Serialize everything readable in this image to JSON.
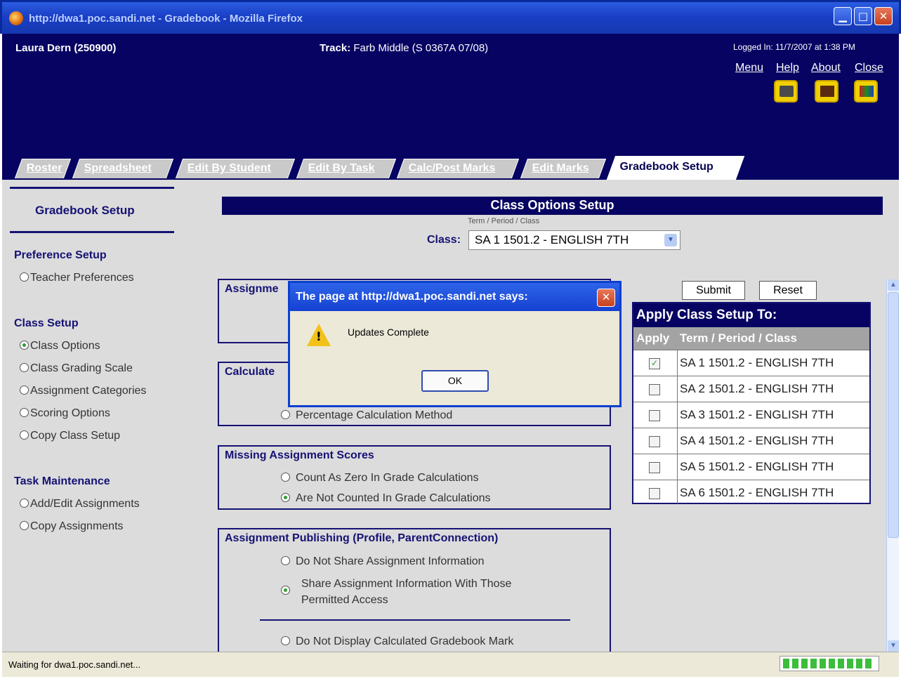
{
  "window": {
    "title": "http://dwa1.poc.sandi.net - Gradebook - Mozilla Firefox"
  },
  "header": {
    "user": "Laura Dern (250900)",
    "track_label": "Track:",
    "track_value": "Farb Middle (S 0367A 07/08)",
    "logged_in": "Logged In: 11/7/2007 at 1:38 PM",
    "links": [
      "Menu",
      "Help",
      "About",
      "Close"
    ],
    "icons": [
      "print-icon",
      "gradebook-icon",
      "report-icon"
    ]
  },
  "tabs": [
    "Roster",
    "Spreadsheet",
    "Edit By Student",
    "Edit By Task",
    "Calc/Post Marks",
    "Edit Marks",
    "Gradebook Setup"
  ],
  "sidebar": {
    "title": "Gradebook Setup",
    "sections": [
      {
        "heading": "Preference Setup",
        "items": [
          {
            "label": "Teacher Preferences",
            "selected": false
          }
        ]
      },
      {
        "heading": "Class Setup",
        "items": [
          {
            "label": "Class Options",
            "selected": true
          },
          {
            "label": "Class Grading Scale",
            "selected": false
          },
          {
            "label": "Assignment Categories",
            "selected": false
          },
          {
            "label": "Scoring Options",
            "selected": false
          },
          {
            "label": "Copy Class Setup",
            "selected": false
          }
        ]
      },
      {
        "heading": "Task Maintenance",
        "items": [
          {
            "label": "Add/Edit Assignments",
            "selected": false
          },
          {
            "label": "Copy Assignments",
            "selected": false
          }
        ]
      }
    ]
  },
  "main": {
    "title": "Class Options Setup",
    "class_caption": "Term / Period / Class",
    "class_label": "Class:",
    "class_value": "SA  1  1501.2 - ENGLISH 7TH",
    "groups": {
      "assignment": {
        "title": "Assignme"
      },
      "calculate": {
        "title": "Calculate",
        "option": "Percentage Calculation Method"
      },
      "missing": {
        "title": "Missing Assignment Scores",
        "options": [
          "Count As Zero In Grade Calculations",
          "Are Not Counted In Grade Calculations"
        ]
      },
      "publishing": {
        "title": "Assignment Publishing (Profile, ParentConnection)",
        "options": [
          "Do Not Share Assignment Information",
          "Share Assignment Information With Those",
          "Permitted Access",
          "Do Not Display Calculated Gradebook Mark"
        ]
      }
    }
  },
  "apply_panel": {
    "submit": "Submit",
    "reset": "Reset",
    "title": "Apply Class Setup To:",
    "col_apply": "Apply",
    "col_class": "Term / Period / Class",
    "rows": [
      {
        "checked": true,
        "label": "SA  1  1501.2 - ENGLISH 7TH"
      },
      {
        "checked": false,
        "label": "SA  2  1501.2 - ENGLISH 7TH"
      },
      {
        "checked": false,
        "label": "SA  3  1501.2 - ENGLISH 7TH"
      },
      {
        "checked": false,
        "label": "SA  4  1501.2 - ENGLISH 7TH"
      },
      {
        "checked": false,
        "label": "SA  5  1501.2 - ENGLISH 7TH"
      },
      {
        "checked": false,
        "label": "SA  6  1501.2 - ENGLISH 7TH"
      }
    ]
  },
  "dialog": {
    "title": "The page at http://dwa1.poc.sandi.net says:",
    "message": "Updates Complete",
    "ok": "OK"
  },
  "status": {
    "text": "Waiting for dwa1.poc.sandi.net...",
    "progress": 1.0
  },
  "colors": {
    "header_navy": "#060362",
    "label_navy": "#151274",
    "content_gray": "#dcdcdc",
    "xp_blue": "#1541d2"
  }
}
